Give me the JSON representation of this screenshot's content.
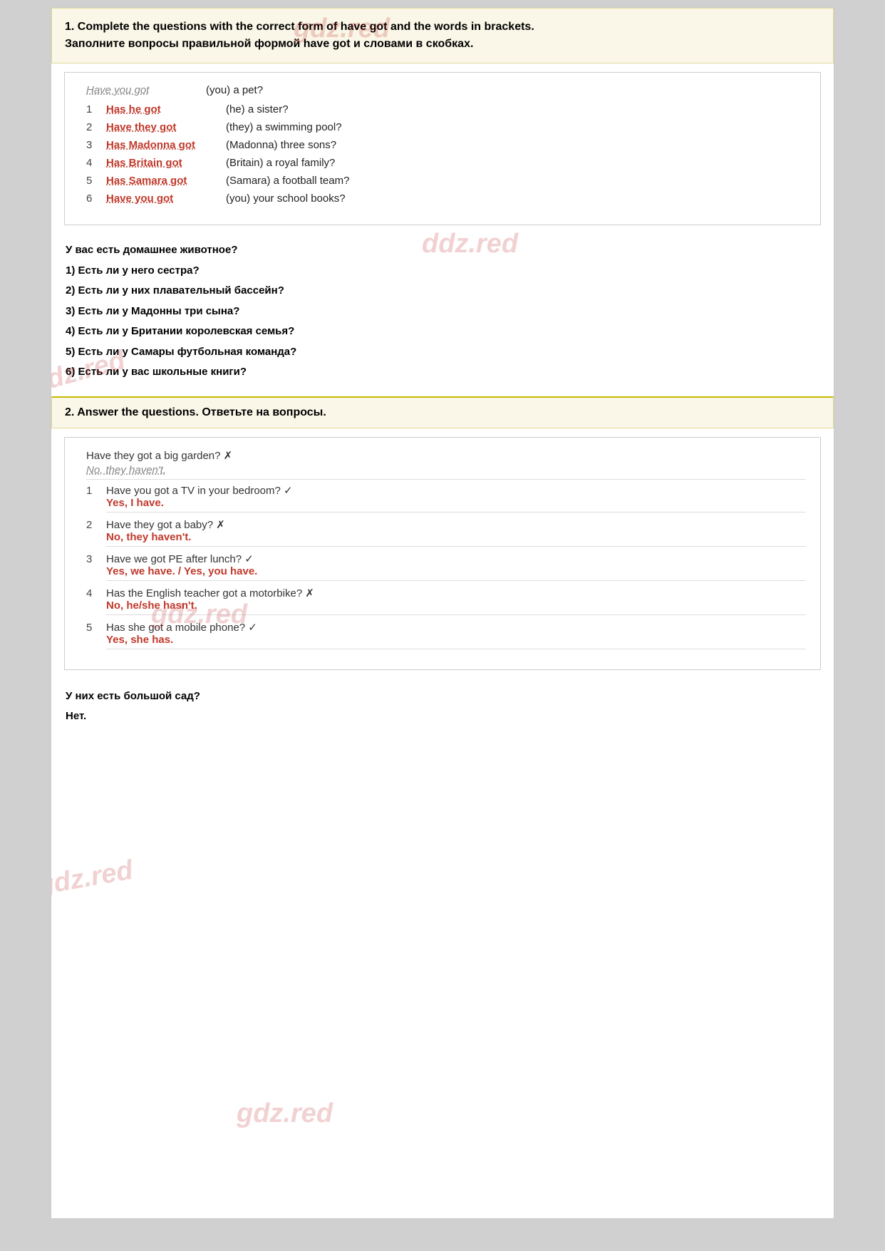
{
  "watermarks": [
    "gdz.red",
    "ddz.red",
    "gdz.red",
    "gdz.red",
    "gdz.red",
    "gdz.red"
  ],
  "section1": {
    "header_en": "1. Complete the questions with the correct form of have got  and the words in brackets.",
    "header_ru": "Заполните вопросы правильной формой have got и словами в скобках.",
    "example": {
      "answer": "Have you got",
      "question": "(you) a pet?"
    },
    "rows": [
      {
        "num": "1",
        "answer": "Has he got",
        "question": "(he) a sister?"
      },
      {
        "num": "2",
        "answer": "Have they got",
        "question": "(they) a swimming pool?"
      },
      {
        "num": "3",
        "answer": "Has Madonna got",
        "question": "(Madonna) three sons?"
      },
      {
        "num": "4",
        "answer": "Has Britain got",
        "question": "(Britain) a royal family?"
      },
      {
        "num": "5",
        "answer": "Has Samara got",
        "question": "(Samara) a football team?"
      },
      {
        "num": "6",
        "answer": "Have you got",
        "question": "(you) your school books?"
      }
    ],
    "translations": [
      "У вас есть домашнее животное?",
      "1) Есть ли у него сестра?",
      "2) Есть ли у них плавательный бассейн?",
      "3) Есть ли у Мадонны три сына?",
      "4) Есть ли у Британии королевская семья?",
      "5) Есть ли у Самары футбольная команда?",
      "6) Есть ли у вас школьные книги?"
    ]
  },
  "section2": {
    "header_en": "2. Answer the questions. Ответьте на вопросы.",
    "example": {
      "question": "Have they got a big garden? ✗",
      "answer": "No, they haven't."
    },
    "rows": [
      {
        "num": "1",
        "question": "Have you got a TV in your bedroom? ✓",
        "answer": "Yes, I have."
      },
      {
        "num": "2",
        "question": "Have they got a baby? ✗",
        "answer": "No, they haven't."
      },
      {
        "num": "3",
        "question": "Have we got PE after lunch? ✓",
        "answer": "Yes, we have. / Yes, you have."
      },
      {
        "num": "4",
        "question": "Has the English teacher got a motorbike? ✗",
        "answer": "No, he/she hasn't."
      },
      {
        "num": "5",
        "question": "Has she got a mobile phone? ✓",
        "answer": "Yes, she has."
      }
    ],
    "translations": [
      "У них есть большой сад?",
      "Нет."
    ]
  }
}
